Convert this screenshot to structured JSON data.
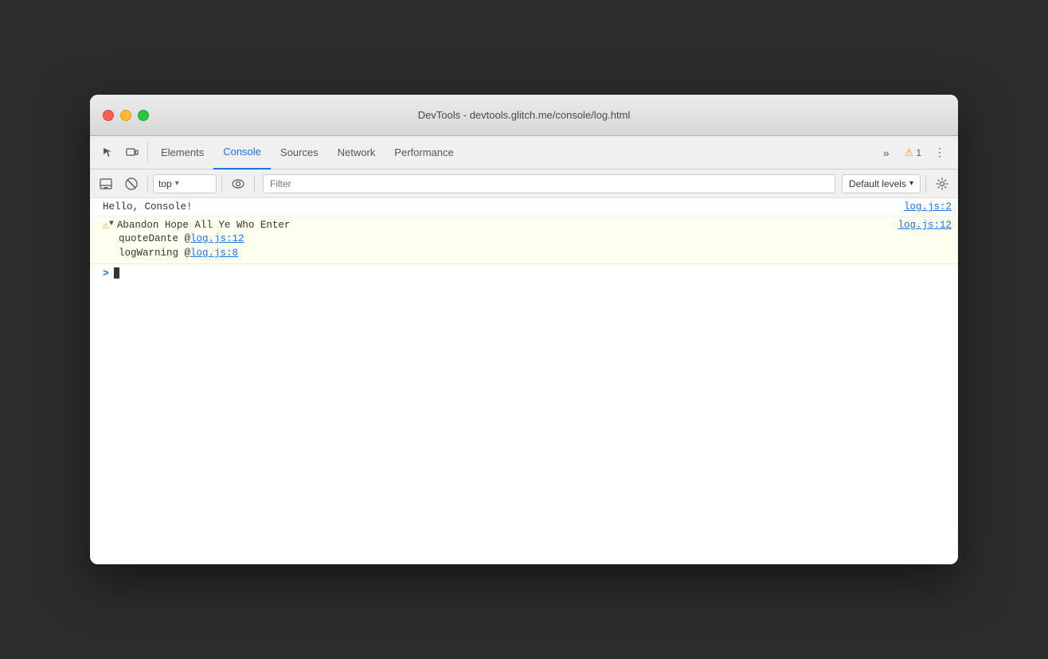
{
  "window": {
    "title": "DevTools - devtools.glitch.me/console/log.html"
  },
  "traffic_lights": {
    "close_label": "close",
    "minimize_label": "minimize",
    "maximize_label": "maximize"
  },
  "tabs": {
    "items": [
      {
        "id": "elements",
        "label": "Elements",
        "active": false
      },
      {
        "id": "console",
        "label": "Console",
        "active": true
      },
      {
        "id": "sources",
        "label": "Sources",
        "active": false
      },
      {
        "id": "network",
        "label": "Network",
        "active": false
      },
      {
        "id": "performance",
        "label": "Performance",
        "active": false
      }
    ],
    "more_label": "»",
    "warning_count": "1",
    "more_tools_label": "⋮"
  },
  "console_toolbar": {
    "clear_label": "🚫",
    "context_value": "top",
    "context_arrow": "▾",
    "eye_icon": "👁",
    "filter_placeholder": "Filter",
    "levels_label": "Default levels",
    "levels_arrow": "▾",
    "settings_label": "⚙"
  },
  "console_entries": [
    {
      "type": "log",
      "message": "Hello, Console!",
      "file_link": "log.js:2"
    },
    {
      "type": "warning",
      "expanded": true,
      "message": "Abandon Hope All Ye Who Enter",
      "file_link": "log.js:12",
      "stack": [
        {
          "label": "quoteDante @ ",
          "link": "log.js:12"
        },
        {
          "label": "logWarning @ ",
          "link": "log.js:8"
        }
      ]
    }
  ],
  "prompt": {
    "caret": ">"
  }
}
